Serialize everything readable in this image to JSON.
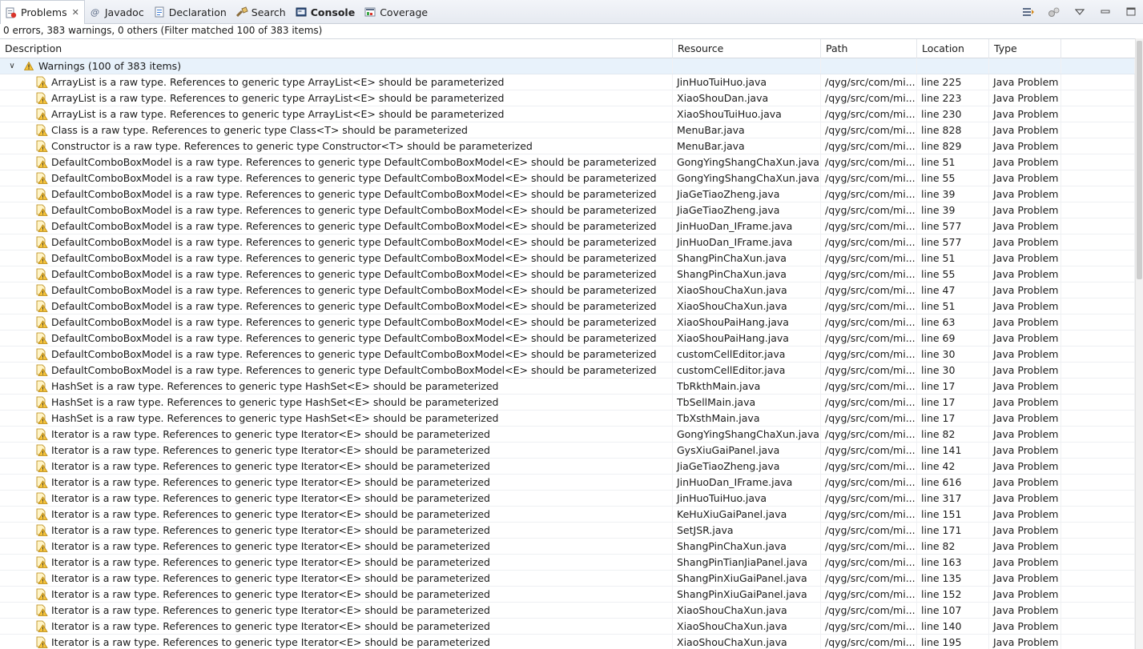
{
  "tabs": [
    {
      "label": "Problems",
      "icon": "problems-icon",
      "active": true,
      "closable": true,
      "bold": false
    },
    {
      "label": "Javadoc",
      "icon": "at-sign-icon",
      "active": false,
      "closable": false,
      "bold": false
    },
    {
      "label": "Declaration",
      "icon": "declaration-icon",
      "active": false,
      "closable": false,
      "bold": false
    },
    {
      "label": "Search",
      "icon": "search-flashlight-icon",
      "active": false,
      "closable": false,
      "bold": false
    },
    {
      "label": "Console",
      "icon": "console-icon",
      "active": false,
      "closable": false,
      "bold": true
    },
    {
      "label": "Coverage",
      "icon": "coverage-icon",
      "active": false,
      "closable": false,
      "bold": false
    }
  ],
  "toolbar": {
    "buttons": [
      "filter-icon",
      "configure-contents-icon",
      "view-menu-icon",
      "minimize-icon",
      "maximize-icon"
    ]
  },
  "summary": "0 errors, 383 warnings, 0 others (Filter matched 100 of 383 items)",
  "columns": {
    "description": "Description",
    "resource": "Resource",
    "path": "Path",
    "location": "Location",
    "type": "Type"
  },
  "group": {
    "label": "Warnings (100 of 383 items)",
    "expanded": true
  },
  "rows": [
    {
      "description": "ArrayList is a raw type. References to generic type ArrayList<E> should be parameterized",
      "resource": "JinHuoTuiHuo.java",
      "path": "/qyg/src/com/mi...",
      "location": "line 225",
      "type": "Java Problem"
    },
    {
      "description": "ArrayList is a raw type. References to generic type ArrayList<E> should be parameterized",
      "resource": "XiaoShouDan.java",
      "path": "/qyg/src/com/mi...",
      "location": "line 223",
      "type": "Java Problem"
    },
    {
      "description": "ArrayList is a raw type. References to generic type ArrayList<E> should be parameterized",
      "resource": "XiaoShouTuiHuo.java",
      "path": "/qyg/src/com/mi...",
      "location": "line 230",
      "type": "Java Problem"
    },
    {
      "description": "Class is a raw type. References to generic type Class<T> should be parameterized",
      "resource": "MenuBar.java",
      "path": "/qyg/src/com/mi...",
      "location": "line 828",
      "type": "Java Problem"
    },
    {
      "description": "Constructor is a raw type. References to generic type Constructor<T> should be parameterized",
      "resource": "MenuBar.java",
      "path": "/qyg/src/com/mi...",
      "location": "line 829",
      "type": "Java Problem"
    },
    {
      "description": "DefaultComboBoxModel is a raw type. References to generic type DefaultComboBoxModel<E> should be parameterized",
      "resource": "GongYingShangChaXun.java",
      "path": "/qyg/src/com/mi...",
      "location": "line 51",
      "type": "Java Problem"
    },
    {
      "description": "DefaultComboBoxModel is a raw type. References to generic type DefaultComboBoxModel<E> should be parameterized",
      "resource": "GongYingShangChaXun.java",
      "path": "/qyg/src/com/mi...",
      "location": "line 55",
      "type": "Java Problem"
    },
    {
      "description": "DefaultComboBoxModel is a raw type. References to generic type DefaultComboBoxModel<E> should be parameterized",
      "resource": "JiaGeTiaoZheng.java",
      "path": "/qyg/src/com/mi...",
      "location": "line 39",
      "type": "Java Problem"
    },
    {
      "description": "DefaultComboBoxModel is a raw type. References to generic type DefaultComboBoxModel<E> should be parameterized",
      "resource": "JiaGeTiaoZheng.java",
      "path": "/qyg/src/com/mi...",
      "location": "line 39",
      "type": "Java Problem"
    },
    {
      "description": "DefaultComboBoxModel is a raw type. References to generic type DefaultComboBoxModel<E> should be parameterized",
      "resource": "JinHuoDan_IFrame.java",
      "path": "/qyg/src/com/mi...",
      "location": "line 577",
      "type": "Java Problem"
    },
    {
      "description": "DefaultComboBoxModel is a raw type. References to generic type DefaultComboBoxModel<E> should be parameterized",
      "resource": "JinHuoDan_IFrame.java",
      "path": "/qyg/src/com/mi...",
      "location": "line 577",
      "type": "Java Problem"
    },
    {
      "description": "DefaultComboBoxModel is a raw type. References to generic type DefaultComboBoxModel<E> should be parameterized",
      "resource": "ShangPinChaXun.java",
      "path": "/qyg/src/com/mi...",
      "location": "line 51",
      "type": "Java Problem"
    },
    {
      "description": "DefaultComboBoxModel is a raw type. References to generic type DefaultComboBoxModel<E> should be parameterized",
      "resource": "ShangPinChaXun.java",
      "path": "/qyg/src/com/mi...",
      "location": "line 55",
      "type": "Java Problem"
    },
    {
      "description": "DefaultComboBoxModel is a raw type. References to generic type DefaultComboBoxModel<E> should be parameterized",
      "resource": "XiaoShouChaXun.java",
      "path": "/qyg/src/com/mi...",
      "location": "line 47",
      "type": "Java Problem"
    },
    {
      "description": "DefaultComboBoxModel is a raw type. References to generic type DefaultComboBoxModel<E> should be parameterized",
      "resource": "XiaoShouChaXun.java",
      "path": "/qyg/src/com/mi...",
      "location": "line 51",
      "type": "Java Problem"
    },
    {
      "description": "DefaultComboBoxModel is a raw type. References to generic type DefaultComboBoxModel<E> should be parameterized",
      "resource": "XiaoShouPaiHang.java",
      "path": "/qyg/src/com/mi...",
      "location": "line 63",
      "type": "Java Problem"
    },
    {
      "description": "DefaultComboBoxModel is a raw type. References to generic type DefaultComboBoxModel<E> should be parameterized",
      "resource": "XiaoShouPaiHang.java",
      "path": "/qyg/src/com/mi...",
      "location": "line 69",
      "type": "Java Problem"
    },
    {
      "description": "DefaultComboBoxModel is a raw type. References to generic type DefaultComboBoxModel<E> should be parameterized",
      "resource": "customCellEditor.java",
      "path": "/qyg/src/com/mi...",
      "location": "line 30",
      "type": "Java Problem"
    },
    {
      "description": "DefaultComboBoxModel is a raw type. References to generic type DefaultComboBoxModel<E> should be parameterized",
      "resource": "customCellEditor.java",
      "path": "/qyg/src/com/mi...",
      "location": "line 30",
      "type": "Java Problem"
    },
    {
      "description": "HashSet is a raw type. References to generic type HashSet<E> should be parameterized",
      "resource": "TbRkthMain.java",
      "path": "/qyg/src/com/mi...",
      "location": "line 17",
      "type": "Java Problem"
    },
    {
      "description": "HashSet is a raw type. References to generic type HashSet<E> should be parameterized",
      "resource": "TbSellMain.java",
      "path": "/qyg/src/com/mi...",
      "location": "line 17",
      "type": "Java Problem"
    },
    {
      "description": "HashSet is a raw type. References to generic type HashSet<E> should be parameterized",
      "resource": "TbXsthMain.java",
      "path": "/qyg/src/com/mi...",
      "location": "line 17",
      "type": "Java Problem"
    },
    {
      "description": "Iterator is a raw type. References to generic type Iterator<E> should be parameterized",
      "resource": "GongYingShangChaXun.java",
      "path": "/qyg/src/com/mi...",
      "location": "line 82",
      "type": "Java Problem"
    },
    {
      "description": "Iterator is a raw type. References to generic type Iterator<E> should be parameterized",
      "resource": "GysXiuGaiPanel.java",
      "path": "/qyg/src/com/mi...",
      "location": "line 141",
      "type": "Java Problem"
    },
    {
      "description": "Iterator is a raw type. References to generic type Iterator<E> should be parameterized",
      "resource": "JiaGeTiaoZheng.java",
      "path": "/qyg/src/com/mi...",
      "location": "line 42",
      "type": "Java Problem"
    },
    {
      "description": "Iterator is a raw type. References to generic type Iterator<E> should be parameterized",
      "resource": "JinHuoDan_IFrame.java",
      "path": "/qyg/src/com/mi...",
      "location": "line 616",
      "type": "Java Problem"
    },
    {
      "description": "Iterator is a raw type. References to generic type Iterator<E> should be parameterized",
      "resource": "JinHuoTuiHuo.java",
      "path": "/qyg/src/com/mi...",
      "location": "line 317",
      "type": "Java Problem"
    },
    {
      "description": "Iterator is a raw type. References to generic type Iterator<E> should be parameterized",
      "resource": "KeHuXiuGaiPanel.java",
      "path": "/qyg/src/com/mi...",
      "location": "line 151",
      "type": "Java Problem"
    },
    {
      "description": "Iterator is a raw type. References to generic type Iterator<E> should be parameterized",
      "resource": "SetJSR.java",
      "path": "/qyg/src/com/mi...",
      "location": "line 171",
      "type": "Java Problem"
    },
    {
      "description": "Iterator is a raw type. References to generic type Iterator<E> should be parameterized",
      "resource": "ShangPinChaXun.java",
      "path": "/qyg/src/com/mi...",
      "location": "line 82",
      "type": "Java Problem"
    },
    {
      "description": "Iterator is a raw type. References to generic type Iterator<E> should be parameterized",
      "resource": "ShangPinTianJiaPanel.java",
      "path": "/qyg/src/com/mi...",
      "location": "line 163",
      "type": "Java Problem"
    },
    {
      "description": "Iterator is a raw type. References to generic type Iterator<E> should be parameterized",
      "resource": "ShangPinXiuGaiPanel.java",
      "path": "/qyg/src/com/mi...",
      "location": "line 135",
      "type": "Java Problem"
    },
    {
      "description": "Iterator is a raw type. References to generic type Iterator<E> should be parameterized",
      "resource": "ShangPinXiuGaiPanel.java",
      "path": "/qyg/src/com/mi...",
      "location": "line 152",
      "type": "Java Problem"
    },
    {
      "description": "Iterator is a raw type. References to generic type Iterator<E> should be parameterized",
      "resource": "XiaoShouChaXun.java",
      "path": "/qyg/src/com/mi...",
      "location": "line 107",
      "type": "Java Problem"
    },
    {
      "description": "Iterator is a raw type. References to generic type Iterator<E> should be parameterized",
      "resource": "XiaoShouChaXun.java",
      "path": "/qyg/src/com/mi...",
      "location": "line 140",
      "type": "Java Problem"
    },
    {
      "description": "Iterator is a raw type. References to generic type Iterator<E> should be parameterized",
      "resource": "XiaoShouChaXun.java",
      "path": "/qyg/src/com/mi...",
      "location": "line 195",
      "type": "Java Problem"
    }
  ],
  "colors": {
    "group_row_bg": "#e8f2fb",
    "warning_yellow": "#f5c33b",
    "warning_outline": "#b8860b"
  }
}
